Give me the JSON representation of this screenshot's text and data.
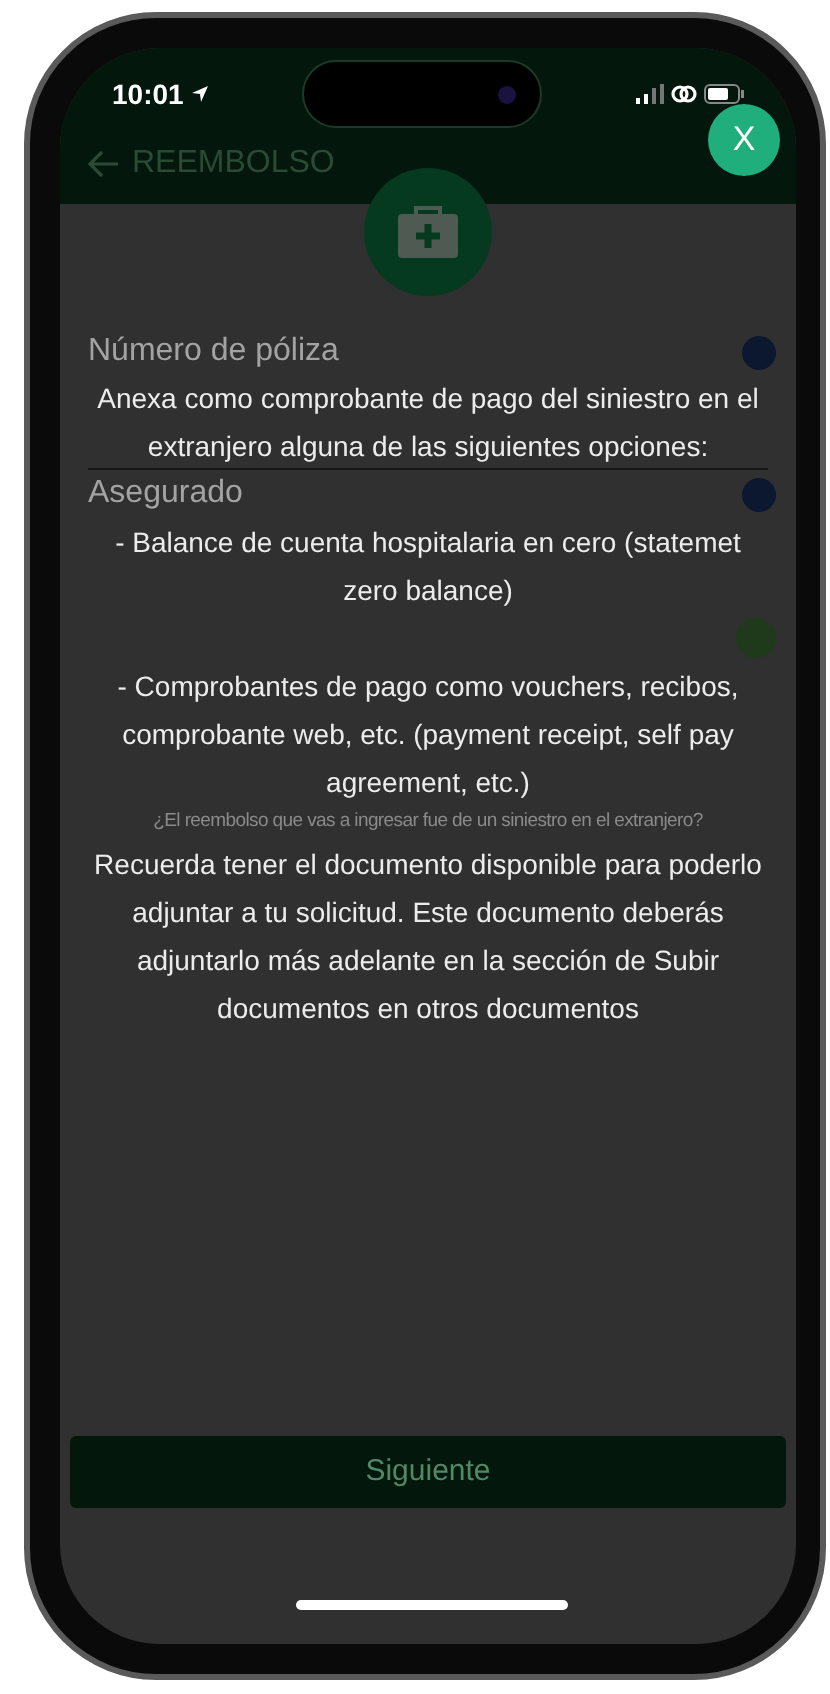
{
  "status_bar": {
    "time": "10:01"
  },
  "header": {
    "title": "REEMBOLSO"
  },
  "close_button": {
    "label": "X"
  },
  "form": {
    "fields": [
      {
        "label": "Número de póliza"
      },
      {
        "label": "Asegurado"
      }
    ],
    "question": "¿El reembolso que vas a ingresar fue de un siniestro en el extranjero?"
  },
  "overlay": {
    "paragraphs": [
      "Anexa como comprobante de pago del siniestro en el extranjero alguna de las siguientes opciones:",
      "- Balance de cuenta hospitalaria en cero (statemet zero balance)",
      "- Comprobantes de pago como vouchers, recibos, comprobante web, etc. (payment receipt, self pay agreement, etc.)",
      "Recuerda tener el documento disponible para poderlo adjuntar a tu solicitud. Este documento deberás adjuntarlo más adelante en la sección de Subir documentos en otros documentos"
    ]
  },
  "next_button": {
    "label": "Siguiente",
    "disabled": true
  }
}
